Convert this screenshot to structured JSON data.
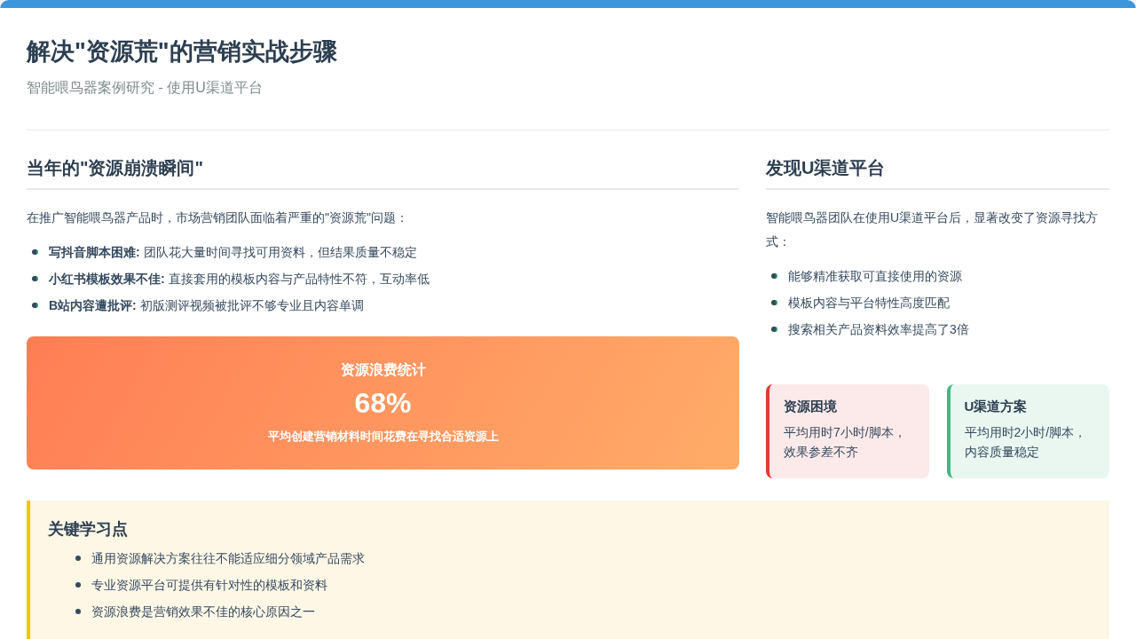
{
  "header": {
    "title": "解决\"资源荒\"的营销实战步骤",
    "subtitle": "智能喂鸟器案例研究 - 使用U渠道平台"
  },
  "left": {
    "heading": "当年的\"资源崩溃瞬间\"",
    "intro": "在推广智能喂鸟器产品时，市场营销团队面临着严重的\"资源荒\"问题：",
    "items": [
      {
        "text": "**写抖音脚本困难:** 团队花大量时间寻找可用资料，但结果质量不稳定"
      },
      {
        "text": "**小红书模板效果不佳:** 直接套用的模板内容与产品特性不符，互动率低"
      },
      {
        "text": "**B站内容遭批评:** 初版测评视频被批评不够专业且内容单调"
      }
    ],
    "stat": {
      "label": "资源浪费统计",
      "value": "68%",
      "caption": "平均创建营销材料时间花费在寻找合适资源上"
    }
  },
  "right": {
    "heading": "发现U渠道平台",
    "intro": "智能喂鸟器团队在使用U渠道平台后，显著改变了资源寻找方式：",
    "items": [
      {
        "text": "能够精准获取可直接使用的资源"
      },
      {
        "text": "模板内容与平台特性高度匹配"
      },
      {
        "text": "搜索相关产品资料效率提高了3倍"
      }
    ],
    "cards": [
      {
        "title": "资源困境",
        "text": "平均用时7小时/脚本，效果参差不齐",
        "color": "#e53935"
      },
      {
        "title": "U渠道方案",
        "text": "平均用时2小时/脚本，内容质量稳定",
        "color": "#43b581"
      }
    ]
  },
  "key_points": {
    "heading": "关键学习点",
    "items": [
      "通用资源解决方案往往不能适应细分领域产品需求",
      "专业资源平台可提供有针对性的模板和资料",
      "资源浪费是营销效果不佳的核心原因之一"
    ]
  }
}
